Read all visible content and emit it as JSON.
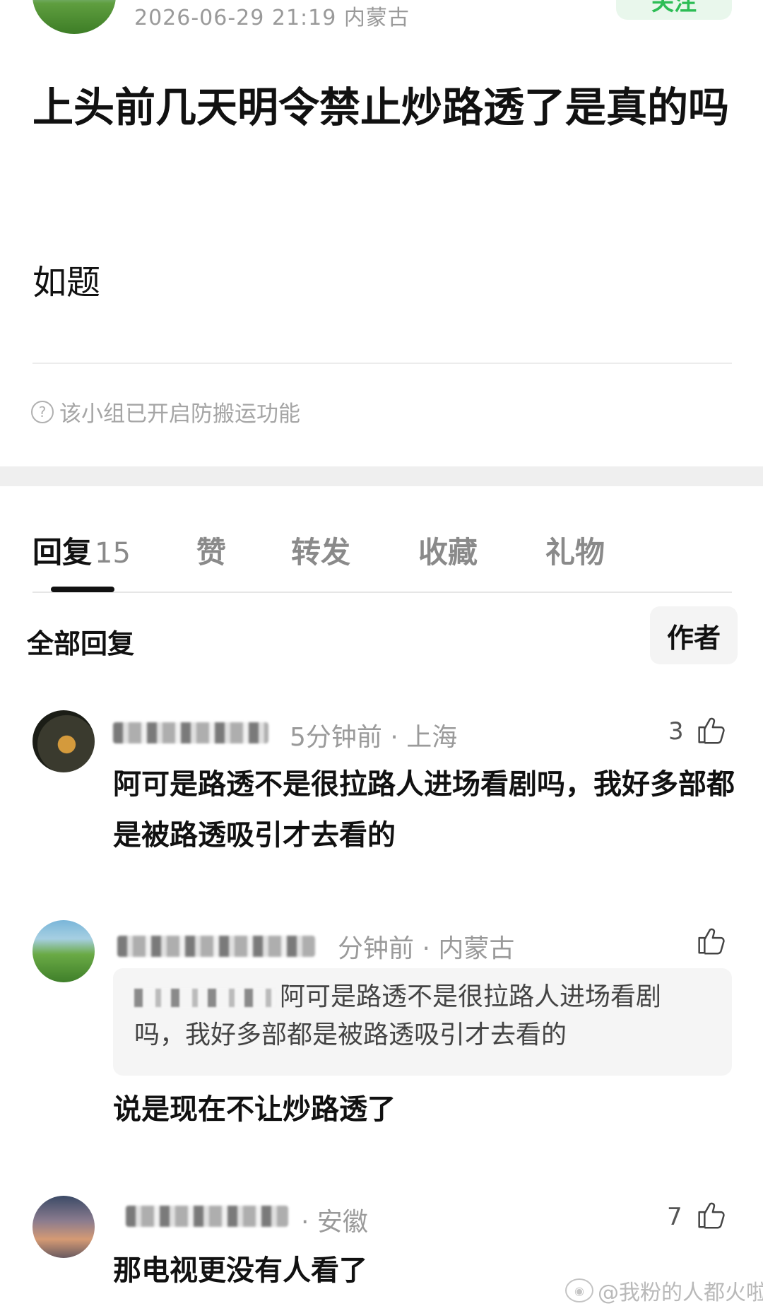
{
  "post": {
    "meta": "2026-06-29 21:19  内蒙古",
    "follow_label": "关注",
    "title": "上头前几天明令禁止炒路透了是真的吗",
    "body": "如题",
    "notice": "该小组已开启防搬运功能"
  },
  "tabs": [
    {
      "label": "回复",
      "count": "15",
      "active": true
    },
    {
      "label": "赞"
    },
    {
      "label": "转发"
    },
    {
      "label": "收藏"
    },
    {
      "label": "礼物"
    }
  ],
  "replies_header": {
    "all_label": "全部回复",
    "author_label": "作者"
  },
  "comments": [
    {
      "meta": "5分钟前 · 上海",
      "likes": "3",
      "text": "阿可是路透不是很拉路人进场看剧吗，我好多部都是被路透吸引才去看的"
    },
    {
      "meta": "分钟前 · 内蒙古",
      "likes": "",
      "quote": "阿可是路透不是很拉路人进场看剧吗，我好多部都是被路透吸引才去看的",
      "text": "说是现在不让炒路透了"
    },
    {
      "meta": "· 安徽",
      "likes": "7",
      "text": "那电视更没有人看了"
    }
  ],
  "watermark": "@我粉的人都火啦"
}
